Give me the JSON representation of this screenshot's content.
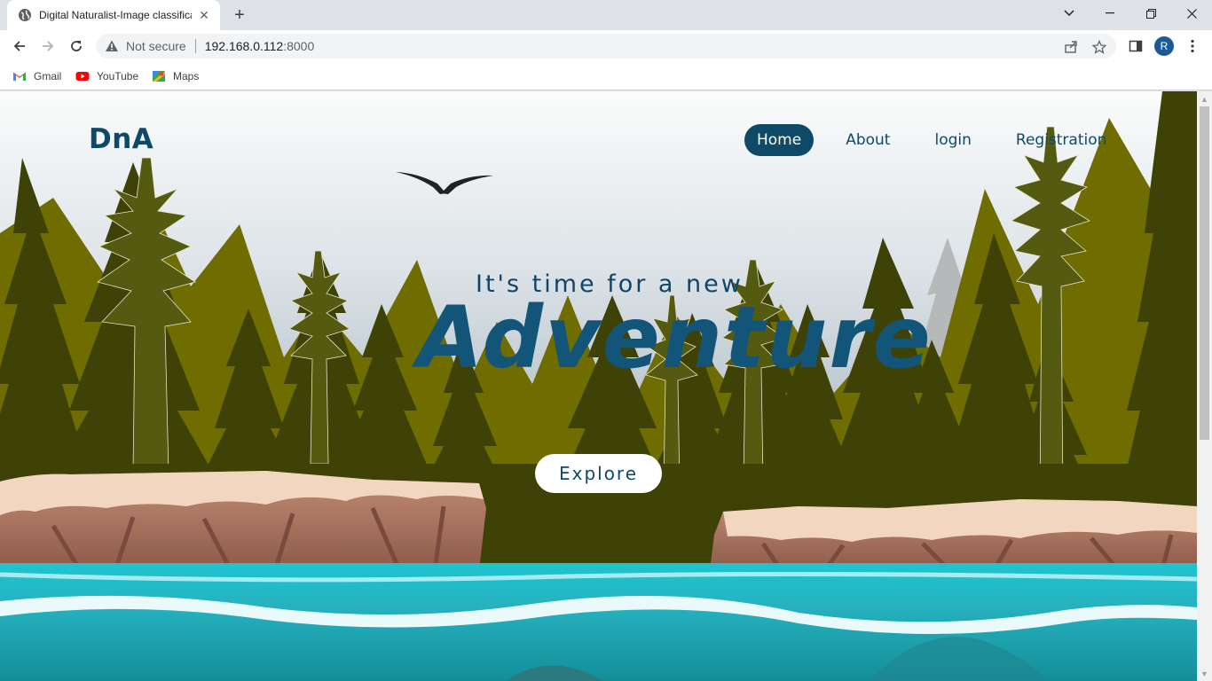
{
  "browser": {
    "tab_title": "Digital Naturalist-Image classifica",
    "security_label": "Not secure",
    "url_host": "192.168.0.112",
    "url_port": ":8000",
    "profile_initial": "R",
    "bookmarks": [
      {
        "label": "Gmail",
        "icon": "gmail-icon"
      },
      {
        "label": "YouTube",
        "icon": "youtube-icon"
      },
      {
        "label": "Maps",
        "icon": "maps-icon"
      }
    ]
  },
  "page": {
    "logo": "DnA",
    "nav": [
      {
        "label": "Home",
        "active": true
      },
      {
        "label": "About",
        "active": false
      },
      {
        "label": "login",
        "active": false
      },
      {
        "label": "Registration",
        "active": false
      }
    ],
    "headline": "It's time for a new",
    "big_word": "Adventure",
    "cta": "Explore"
  },
  "colors": {
    "brand": "#0e4a68",
    "forest_dark": "#3e4206",
    "forest_olive": "#6f6f00",
    "water": "#24b5c2"
  }
}
